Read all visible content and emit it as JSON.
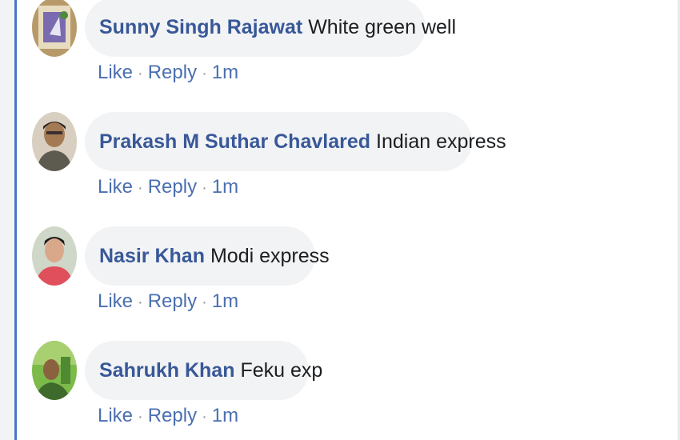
{
  "comments": [
    {
      "author": "Sunny Singh Rajawat",
      "text": "White green well",
      "like": "Like",
      "reply": "Reply",
      "time": "1m",
      "sep": "·"
    },
    {
      "author": "Prakash M Suthar Chavlared",
      "text": "Indian express",
      "like": "Like",
      "reply": "Reply",
      "time": "1m",
      "sep": "·"
    },
    {
      "author": "Nasir Khan",
      "text": "Modi express",
      "like": "Like",
      "reply": "Reply",
      "time": "1m",
      "sep": "·"
    },
    {
      "author": "Sahrukh Khan",
      "text": "Feku exp",
      "like": "Like",
      "reply": "Reply",
      "time": "1m",
      "sep": "·"
    }
  ]
}
